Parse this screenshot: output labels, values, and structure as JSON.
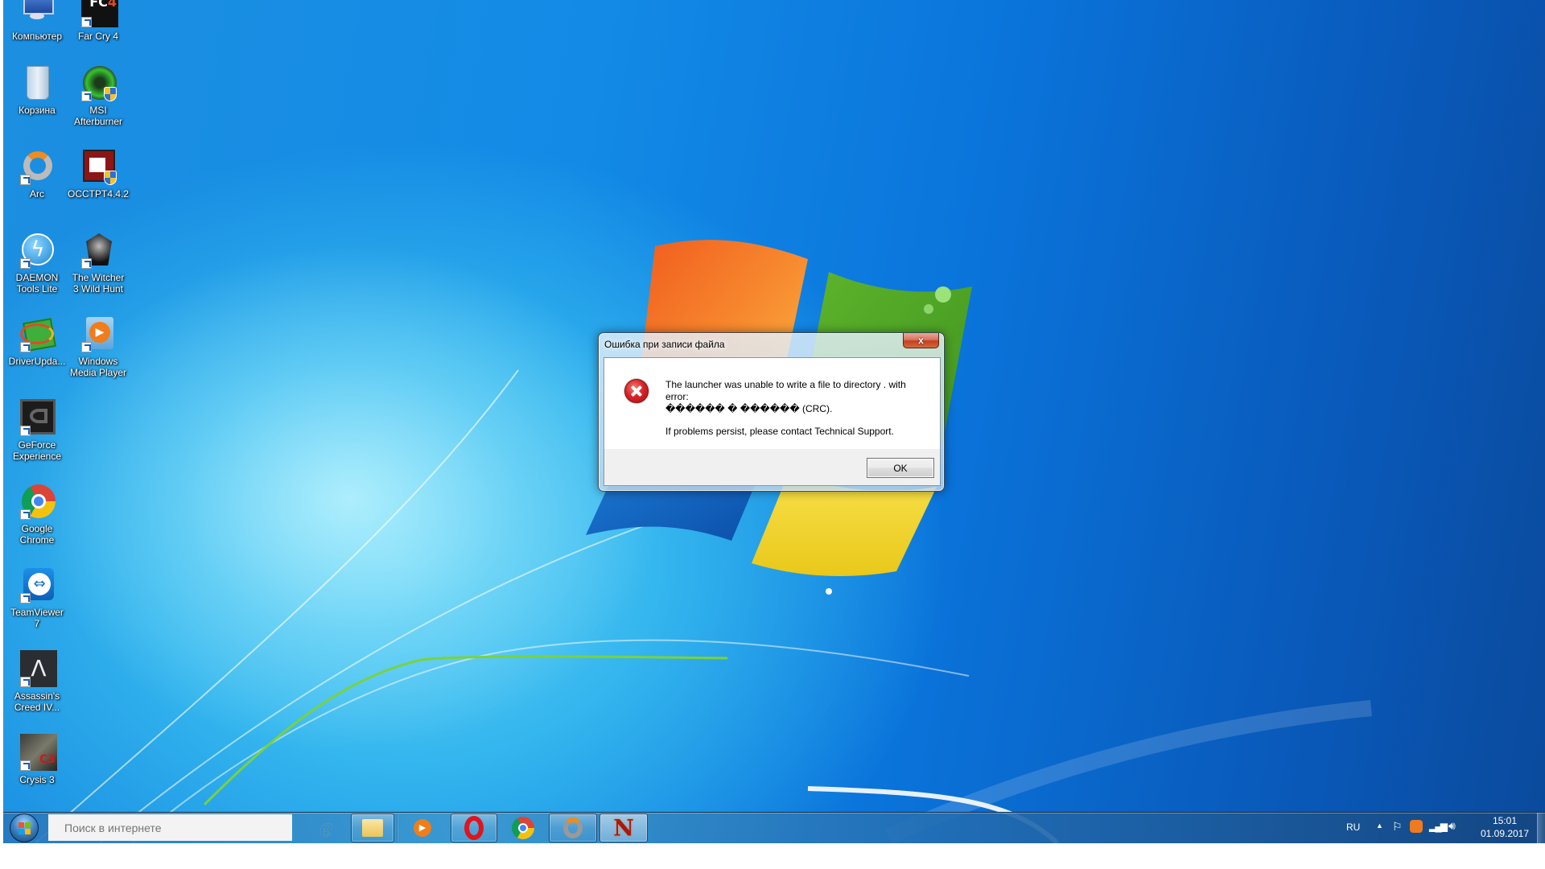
{
  "desktop_icons": [
    {
      "label_lines": [
        "Компьютер"
      ],
      "icon": "computer-icon"
    },
    {
      "label_lines": [
        "Far Cry 4"
      ],
      "icon": "farcry4-icon"
    },
    {
      "label_lines": [
        "Корзина"
      ],
      "icon": "recycle-bin-icon"
    },
    {
      "label_lines": [
        "MSI",
        "Afterburner"
      ],
      "icon": "msi-afterburner-icon"
    },
    {
      "label_lines": [
        "Arc"
      ],
      "icon": "arc-icon"
    },
    {
      "label_lines": [
        "OCCTPT4.4.2"
      ],
      "icon": "occt-icon"
    },
    {
      "label_lines": [
        "DAEMON",
        "Tools Lite"
      ],
      "icon": "daemon-tools-icon"
    },
    {
      "label_lines": [
        "The Witcher",
        "3 Wild Hunt"
      ],
      "icon": "witcher-icon"
    },
    {
      "label_lines": [
        "DriverUpda..."
      ],
      "icon": "driver-updater-icon"
    },
    {
      "label_lines": [
        "Windows",
        "Media Player"
      ],
      "icon": "windows-media-player-icon"
    },
    {
      "label_lines": [
        "GeForce",
        "Experience"
      ],
      "icon": "geforce-experience-icon"
    },
    {
      "label_lines": [
        "Google",
        "Chrome"
      ],
      "icon": "chrome-icon"
    },
    {
      "label_lines": [
        "TeamViewer",
        "7"
      ],
      "icon": "teamviewer-icon"
    },
    {
      "label_lines": [
        "Assassin's",
        "Creed IV..."
      ],
      "icon": "assassins-creed-icon"
    },
    {
      "label_lines": [
        "Crysis 3"
      ],
      "icon": "crysis3-icon"
    }
  ],
  "dialog": {
    "title": "Ошибка при записи файла",
    "close_label": "x",
    "icon": "error-icon",
    "message_line1": "The launcher was unable to write a file to directory . with error:",
    "message_line2": "������ � ������ (CRC).",
    "message_line3": "If problems persist, please contact Technical Support.",
    "ok_label": "OK"
  },
  "taskbar": {
    "search_placeholder": "Поиск в интернете",
    "pinned": [
      {
        "name": "internet-explorer",
        "icon": "ie-icon",
        "running": false
      },
      {
        "name": "file-explorer",
        "icon": "folder-icon",
        "running": true
      },
      {
        "name": "windows-media-player",
        "icon": "media-player-icon",
        "running": false
      },
      {
        "name": "opera",
        "icon": "opera-icon",
        "running": true
      },
      {
        "name": "chrome",
        "icon": "chrome-icon",
        "running": false
      },
      {
        "name": "arc",
        "icon": "arc-icon",
        "running": true
      },
      {
        "name": "launcher",
        "icon": "n-logo-icon",
        "running": true,
        "active": true
      }
    ],
    "tray": {
      "language": "RU",
      "time": "15:01",
      "date": "01.09.2017"
    }
  },
  "colors": {
    "error_red": "#d9252a",
    "taskbar_blue": "#2878be",
    "desktop_blue": "#138be6"
  }
}
